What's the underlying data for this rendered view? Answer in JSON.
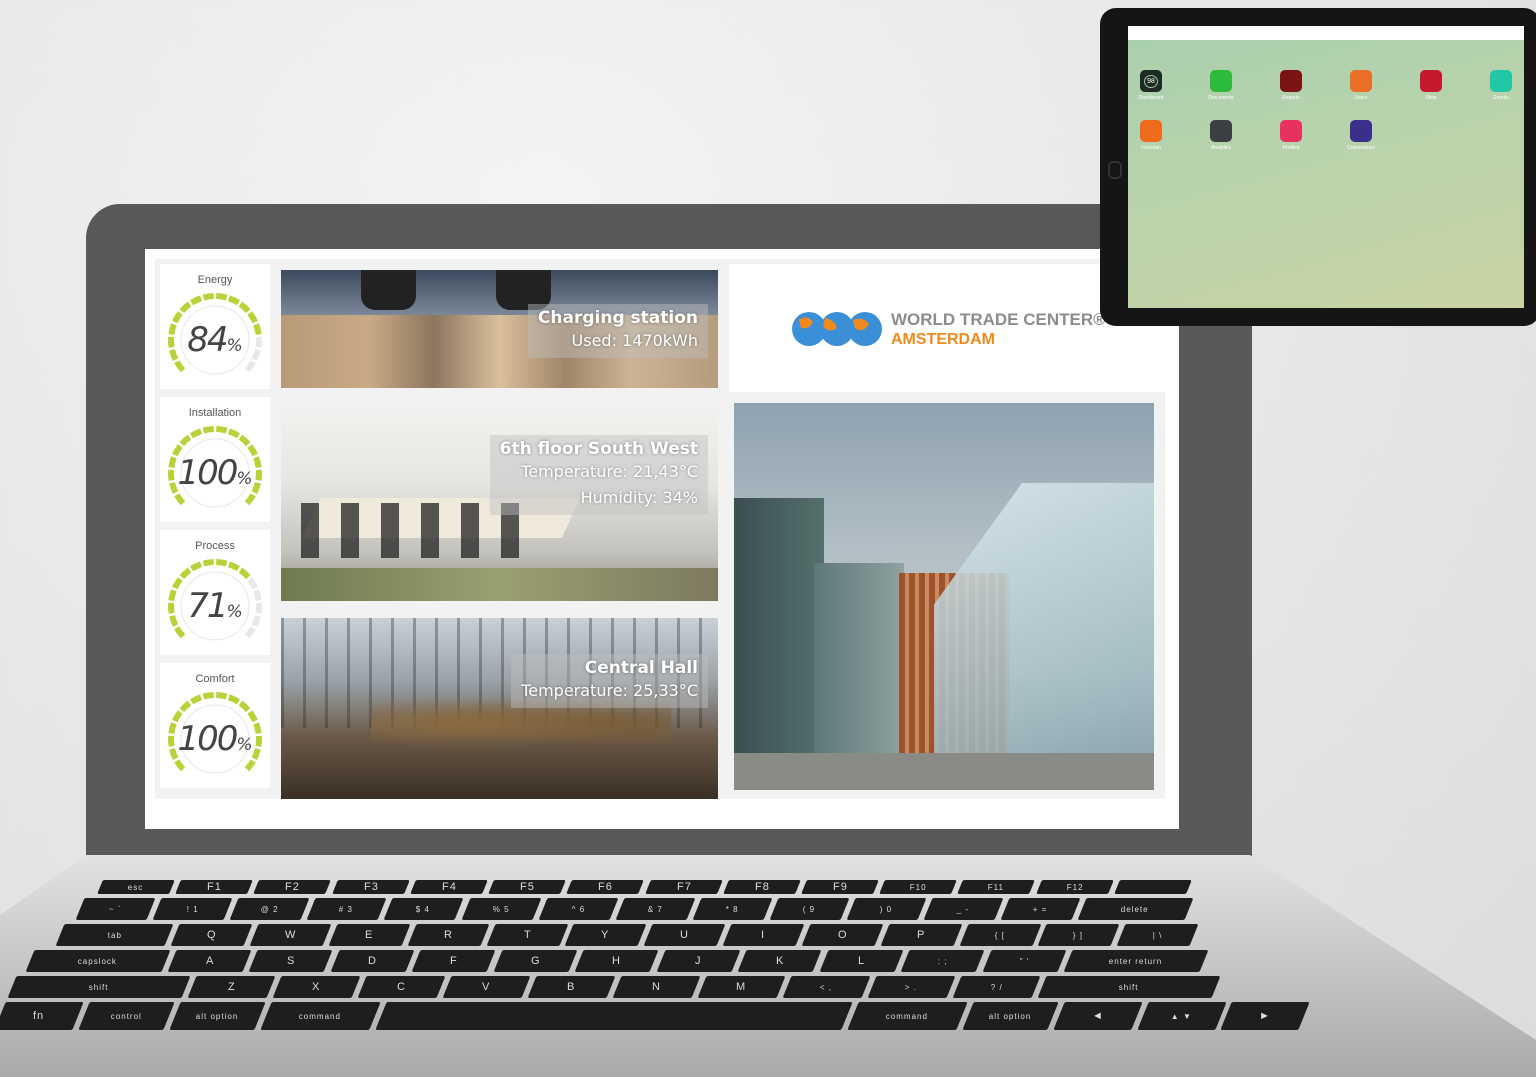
{
  "gauges": [
    {
      "label": "Energy",
      "value": "84",
      "unit": "%",
      "level": 0.84
    },
    {
      "label": "Installation",
      "value": "100",
      "unit": "%",
      "level": 1.0
    },
    {
      "label": "Process",
      "value": "71",
      "unit": "%",
      "level": 0.71
    },
    {
      "label": "Comfort",
      "value": "100",
      "unit": "%",
      "level": 1.0
    }
  ],
  "tiles": {
    "charging": {
      "title": "Charging station",
      "line1": "Used: 1470kWh"
    },
    "floor": {
      "title": "6th floor South West",
      "line1": "Temperature: 21,43°C",
      "line2": "Humidity: 34%"
    },
    "hall": {
      "title": "Central Hall",
      "line1": "Temperature: 25,33°C"
    }
  },
  "logo": {
    "line1": "WORLD TRADE CENTER®",
    "line2": "AMSTERDAM"
  },
  "ipad_apps": [
    {
      "name": "Dashboard",
      "badge": "98",
      "color": "#1e2a24"
    },
    {
      "name": "Documents",
      "color": "#2dbb3a"
    },
    {
      "name": "Reports",
      "color": "#7a1316"
    },
    {
      "name": "Users",
      "color": "#e86f25"
    },
    {
      "name": "Sites",
      "color": "#c8182d"
    },
    {
      "name": "Events",
      "color": "#22c7a5"
    },
    {
      "name": "Historian",
      "color": "#ef6b1c"
    },
    {
      "name": "Analytics",
      "color": "#3c3f44"
    },
    {
      "name": "Profiles",
      "color": "#e9315f"
    },
    {
      "name": "Connections",
      "color": "#3b2f8c"
    }
  ],
  "keyboard": {
    "rows": [
      [
        "esc",
        "F1",
        "F2",
        "F3",
        "F4",
        "F5",
        "F6",
        "F7",
        "F8",
        "F9",
        "F10",
        "F11",
        "F12",
        ""
      ],
      [
        "~ `",
        "! 1",
        "@ 2",
        "# 3",
        "$ 4",
        "% 5",
        "^ 6",
        "& 7",
        "* 8",
        "( 9",
        ") 0",
        "_ -",
        "+ =",
        "delete"
      ],
      [
        "tab",
        "Q",
        "W",
        "E",
        "R",
        "T",
        "Y",
        "U",
        "I",
        "O",
        "P",
        "{ [",
        "} ]",
        "| \\"
      ],
      [
        "capslock",
        "A",
        "S",
        "D",
        "F",
        "G",
        "H",
        "J",
        "K",
        "L",
        ": ;",
        "\" '",
        "enter return"
      ],
      [
        "shift",
        "Z",
        "X",
        "C",
        "V",
        "B",
        "N",
        "M",
        "< ,",
        "> .",
        "? /",
        "shift"
      ],
      [
        "fn",
        "control",
        "alt option",
        "command",
        "",
        "command",
        "alt option",
        "◄",
        "▲ ▼",
        "►"
      ]
    ]
  },
  "colors": {
    "gauge": "#b8d23a",
    "gauge_track": "#e8e8e8",
    "laptop": "#595959",
    "keys": "#1e1e1e"
  }
}
